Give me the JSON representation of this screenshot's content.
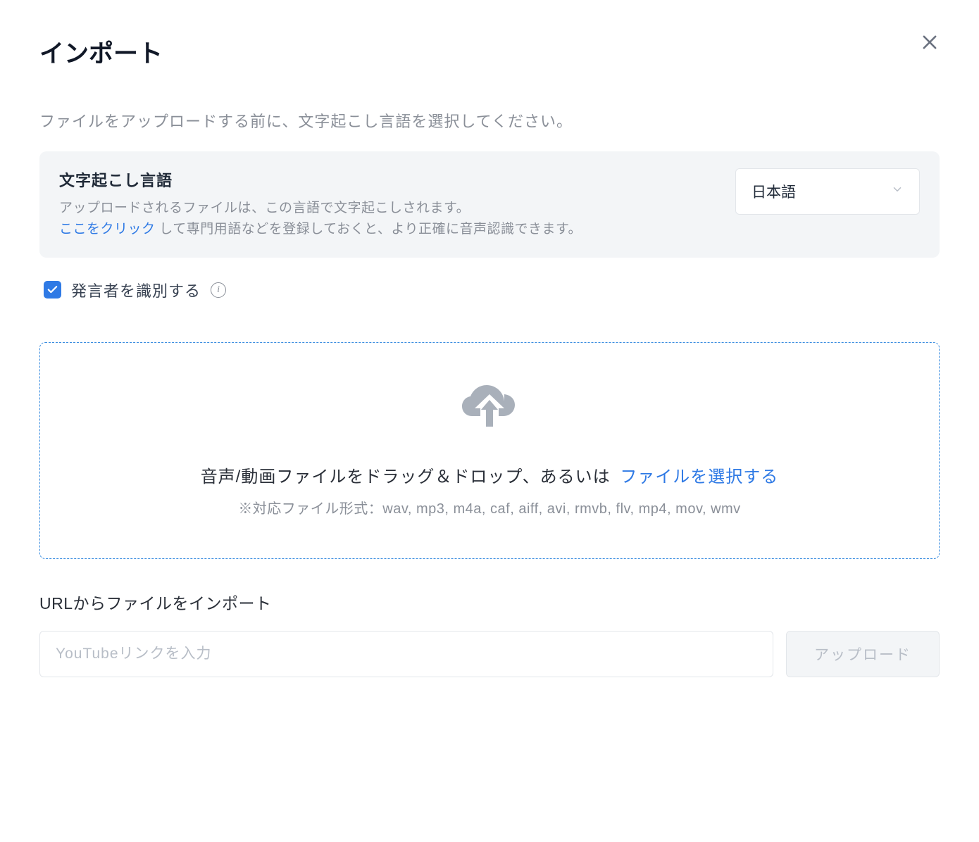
{
  "modal": {
    "title": "インポート",
    "subtitle": "ファイルをアップロードする前に、文字起こし言語を選択してください。"
  },
  "language": {
    "heading": "文字起こし言語",
    "desc_line1": "アップロードされるファイルは、この言語で文字起こしされます。",
    "link_text": "ここをクリック",
    "desc_line2_after_link": " して専門用語などを登録しておくと、より正確に音声認識できます。",
    "selected": "日本語"
  },
  "speaker": {
    "label": "発言者を識別する",
    "checked": true
  },
  "dropzone": {
    "main_text": "音声/動画ファイルをドラッグ＆ドロップ、あるいは ",
    "link_text": "ファイルを選択する",
    "formats": "※対応ファイル形式：wav, mp3, m4a, caf, aiff, avi, rmvb, flv, mp4, mov, wmv"
  },
  "url": {
    "section_label": "URLからファイルをインポート",
    "placeholder": "YouTubeリンクを入力",
    "button_label": "アップロード"
  }
}
